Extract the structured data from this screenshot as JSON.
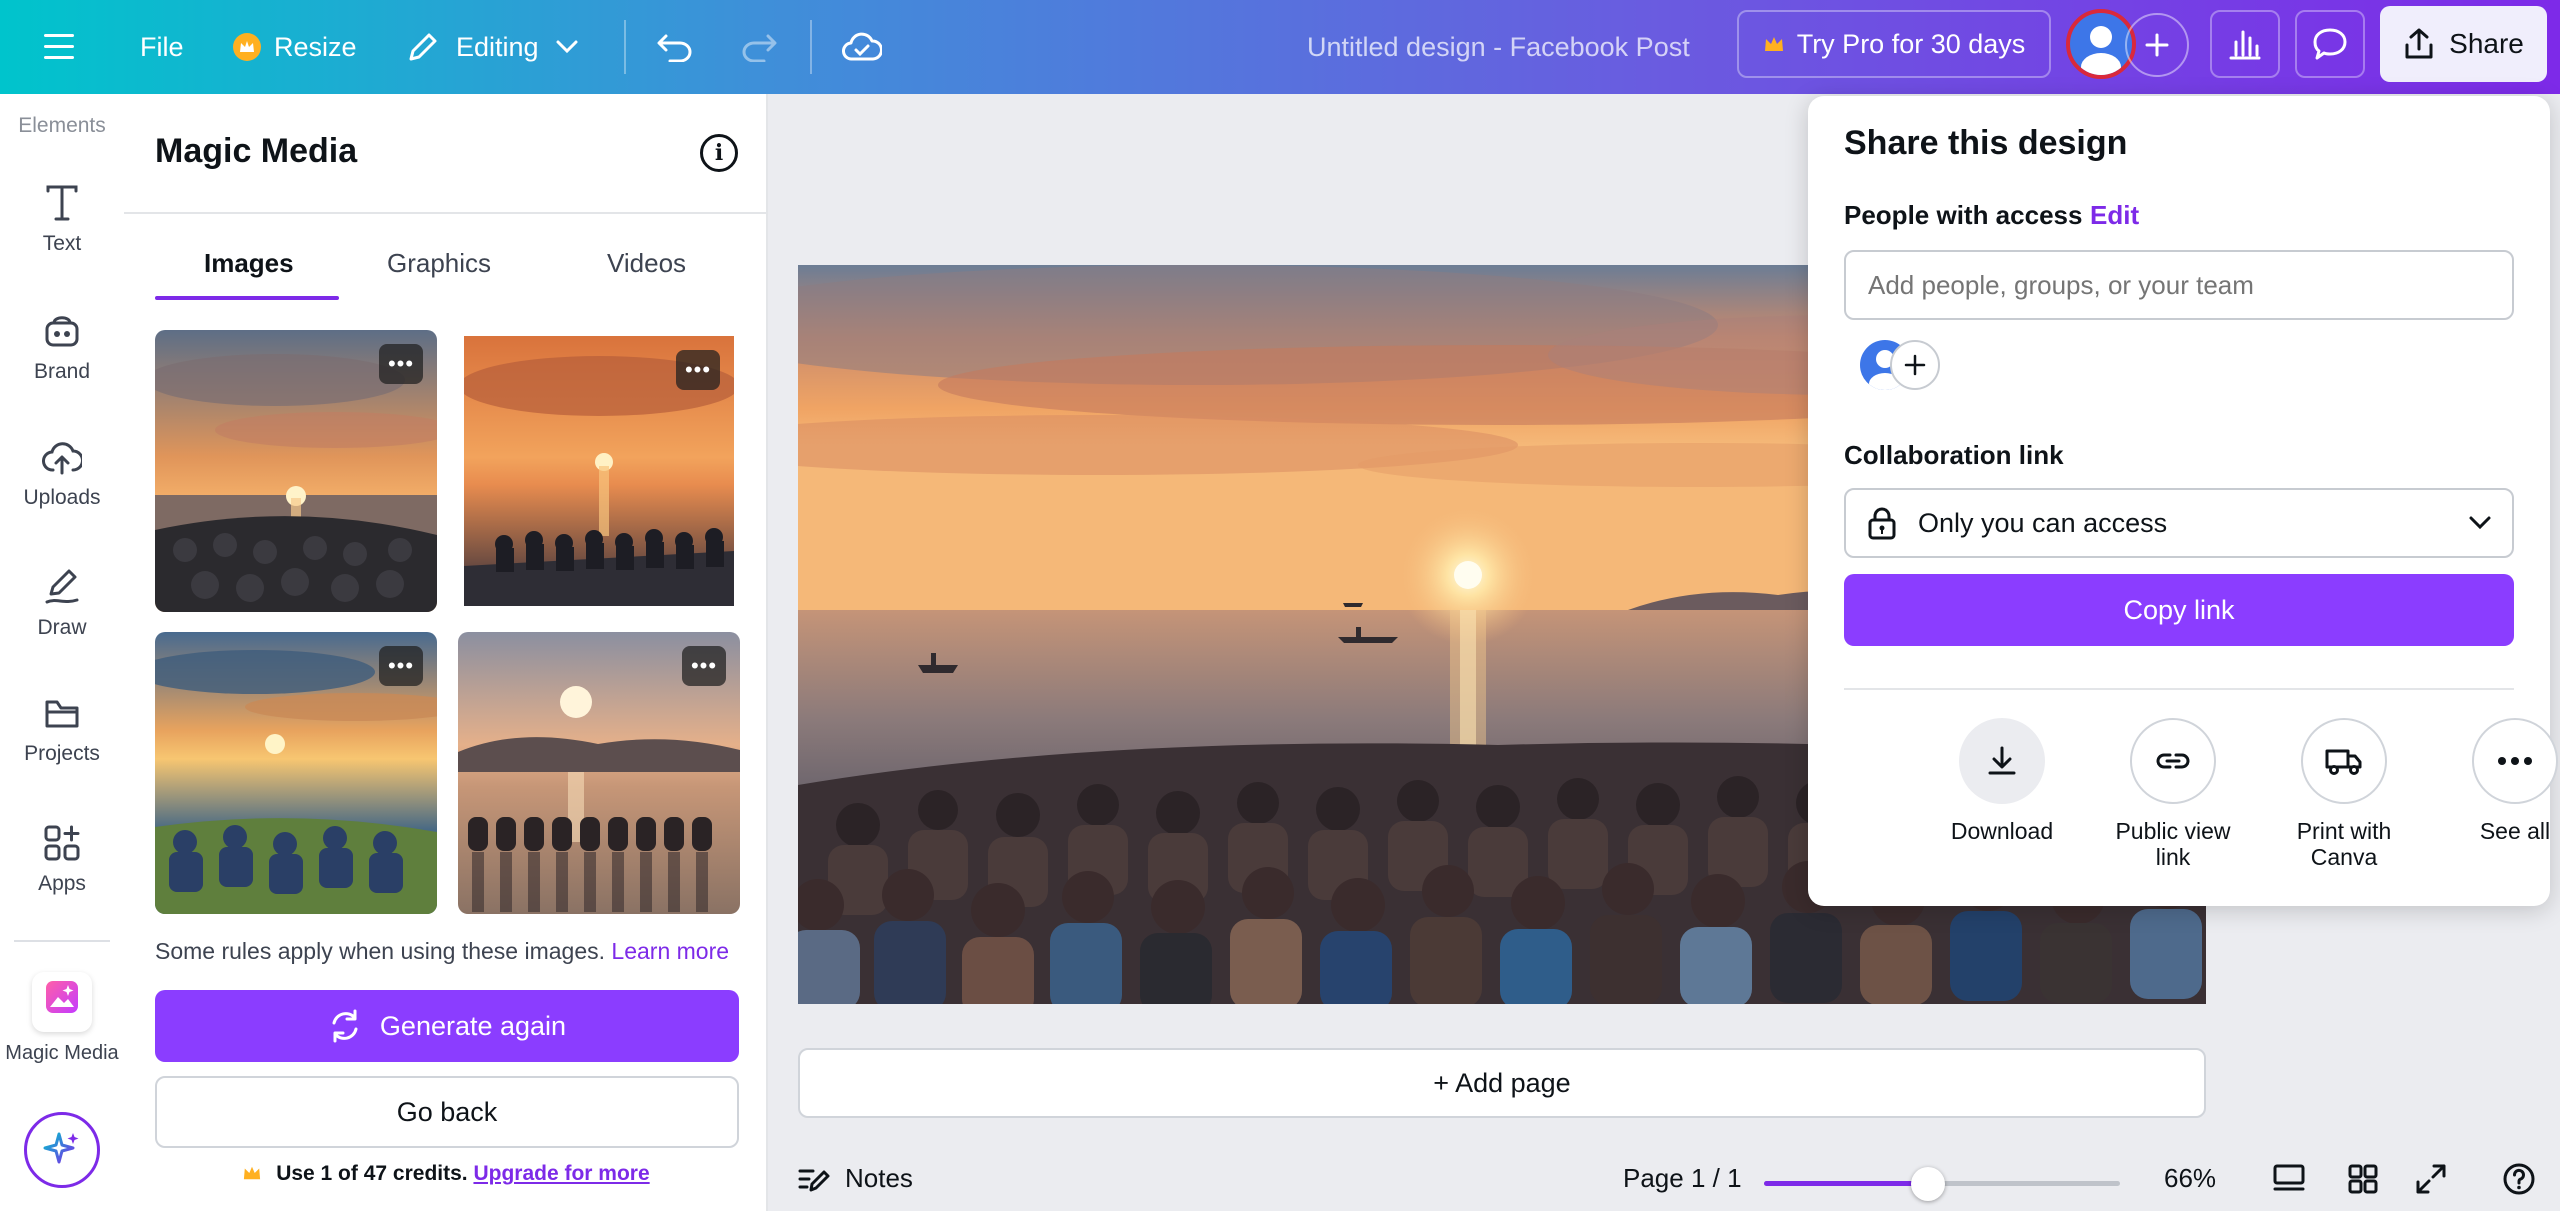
{
  "topbar": {
    "file_label": "File",
    "resize_label": "Resize",
    "editing_label": "Editing",
    "design_title": "Untitled design - Facebook Post",
    "pro_label": "Try Pro for 30 days",
    "share_label": "Share"
  },
  "rail": {
    "items": [
      {
        "label": "Elements",
        "icon": "elements-icon"
      },
      {
        "label": "Text",
        "icon": "text-icon"
      },
      {
        "label": "Brand",
        "icon": "brand-icon"
      },
      {
        "label": "Uploads",
        "icon": "uploads-icon"
      },
      {
        "label": "Draw",
        "icon": "draw-icon"
      },
      {
        "label": "Projects",
        "icon": "folder-icon"
      },
      {
        "label": "Apps",
        "icon": "apps-icon"
      },
      {
        "label": "Magic Media",
        "icon": "magic-media-icon"
      }
    ]
  },
  "panel": {
    "title": "Magic Media",
    "tabs": [
      {
        "label": "Images",
        "active": true
      },
      {
        "label": "Graphics",
        "active": false
      },
      {
        "label": "Videos",
        "active": false
      }
    ],
    "rules_text": "Some rules apply when using these images.",
    "learn_more": "Learn more",
    "generate_again": "Generate again",
    "go_back": "Go back",
    "credits_text": "Use 1 of 47 credits.",
    "credits_upgrade": "Upgrade for more"
  },
  "canvas": {
    "add_page": "+ Add page"
  },
  "bottombar": {
    "notes_label": "Notes",
    "page_indicator": "Page 1 / 1",
    "zoom_percent": "66%",
    "zoom_fraction": 0.46
  },
  "share": {
    "title": "Share this design",
    "people_label": "People with access",
    "edit_label": "Edit",
    "input_placeholder": "Add people, groups, or your team",
    "collab_label": "Collaboration link",
    "access_value": "Only you can access",
    "copy_link": "Copy link",
    "actions": [
      {
        "label": "Download",
        "icon": "download-icon"
      },
      {
        "label": "Public view link",
        "icon": "link-icon"
      },
      {
        "label": "Print with Canva",
        "icon": "truck-icon"
      },
      {
        "label": "See all",
        "icon": "more-icon"
      }
    ]
  },
  "colors": {
    "accent": "#8b3dff",
    "link": "#7d2ae8",
    "gradient_start": "#00c4cc",
    "gradient_end": "#7d2ae8"
  }
}
